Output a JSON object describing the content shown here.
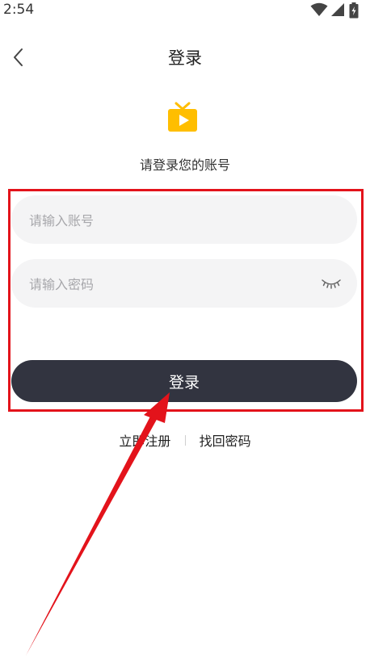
{
  "status_bar": {
    "time": "2:54"
  },
  "nav": {
    "title": "登录"
  },
  "header": {
    "subtitle": "请登录您的账号"
  },
  "form": {
    "account_placeholder": "请输入账号",
    "account_value": "",
    "password_placeholder": "请输入密码",
    "password_value": "",
    "login_label": "登录"
  },
  "footer": {
    "register_label": "立即注册",
    "recover_label": "找回密码"
  },
  "icons": {
    "back": "chevron-left-icon",
    "logo": "tv-play-icon",
    "eye": "eye-closed-icon",
    "wifi": "wifi-icon",
    "signal": "signal-icon",
    "battery": "battery-charging-icon"
  },
  "colors": {
    "logo": "#ffbe00",
    "button_bg": "#323440",
    "input_bg": "#f4f4f5",
    "annotation_red": "#e3131b"
  }
}
